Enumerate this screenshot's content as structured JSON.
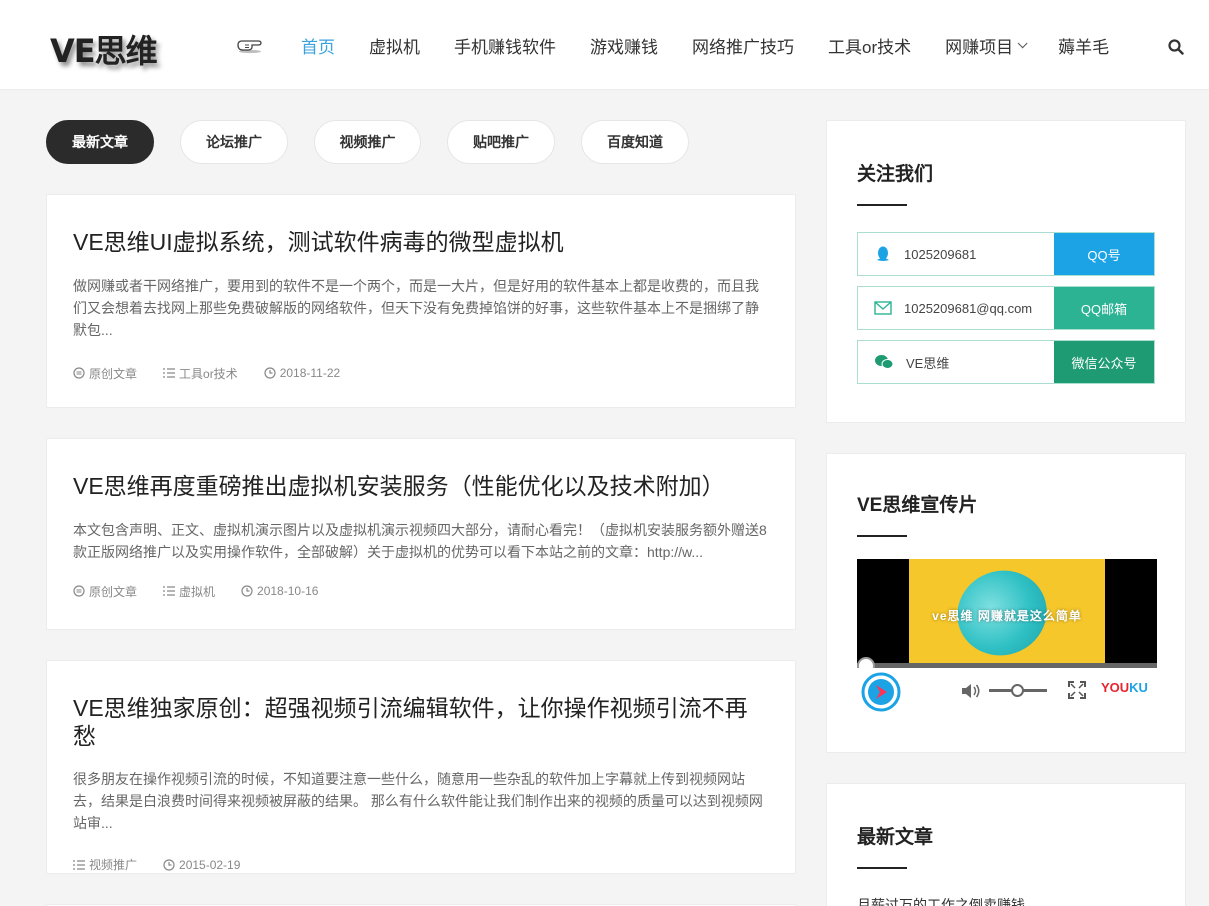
{
  "header": {
    "logo": "VE思维",
    "nav": [
      {
        "label": "首页",
        "active": true
      },
      {
        "label": "虚拟机"
      },
      {
        "label": "手机赚钱软件"
      },
      {
        "label": "游戏赚钱"
      },
      {
        "label": "网络推广技巧"
      },
      {
        "label": "工具or技术"
      },
      {
        "label": "网赚项目",
        "dropdown": true
      },
      {
        "label": "薅羊毛"
      }
    ]
  },
  "tabs": [
    {
      "label": "最新文章",
      "active": true
    },
    {
      "label": "论坛推广"
    },
    {
      "label": "视频推广"
    },
    {
      "label": "贴吧推广"
    },
    {
      "label": "百度知道"
    }
  ],
  "articles": [
    {
      "title": "VE思维UI虚拟系统，测试软件病毒的微型虚拟机",
      "excerpt": "做网赚或者干网络推广，要用到的软件不是一个两个，而是一大片，但是好用的软件基本上都是收费的，而且我们又会想着去找网上那些免费破解版的网络软件，但天下没有免费掉馅饼的好事，这些软件基本上不是捆绑了静默包...",
      "type": "原创文章",
      "category": "工具or技术",
      "date": "2018-11-22"
    },
    {
      "title": "VE思维再度重磅推出虚拟机安装服务（性能优化以及技术附加）",
      "excerpt": "本文包含声明、正文、虚拟机演示图片以及虚拟机演示视频四大部分，请耐心看完！（虚拟机安装服务额外赠送8款正版网络推广以及实用操作软件，全部破解）关于虚拟机的优势可以看下本站之前的文章：http://w...",
      "type": "原创文章",
      "category": "虚拟机",
      "date": "2018-10-16"
    },
    {
      "title": "VE思维独家原创：超强视频引流编辑软件，让你操作视频引流不再愁",
      "excerpt": "很多朋友在操作视频引流的时候，不知道要注意一些什么，随意用一些杂乱的软件加上字幕就上传到视频网站去，结果是白浪费时间得来视频被屏蔽的结果。 那么有什么软件能让我们制作出来的视频的质量可以达到视频网站审...",
      "category": "视频推广",
      "date": "2015-02-19"
    }
  ],
  "sidebar": {
    "follow": {
      "title": "关注我们",
      "rows": [
        {
          "value": "1025209681",
          "button": "QQ号",
          "color": "#1ba3e6"
        },
        {
          "value": "1025209681@qq.com",
          "button": "QQ邮箱",
          "color": "#2bb394"
        },
        {
          "value": "VE思维",
          "button": "微信公众号",
          "color": "#1e9b72"
        }
      ]
    },
    "promo": {
      "title": "VE思维宣传片",
      "caption": "ve思维 网赚就是这么简单",
      "brand": "YOUKU"
    },
    "latest": {
      "title": "最新文章",
      "items": [
        "月薪过万的工作之倒卖赚钱"
      ]
    }
  }
}
